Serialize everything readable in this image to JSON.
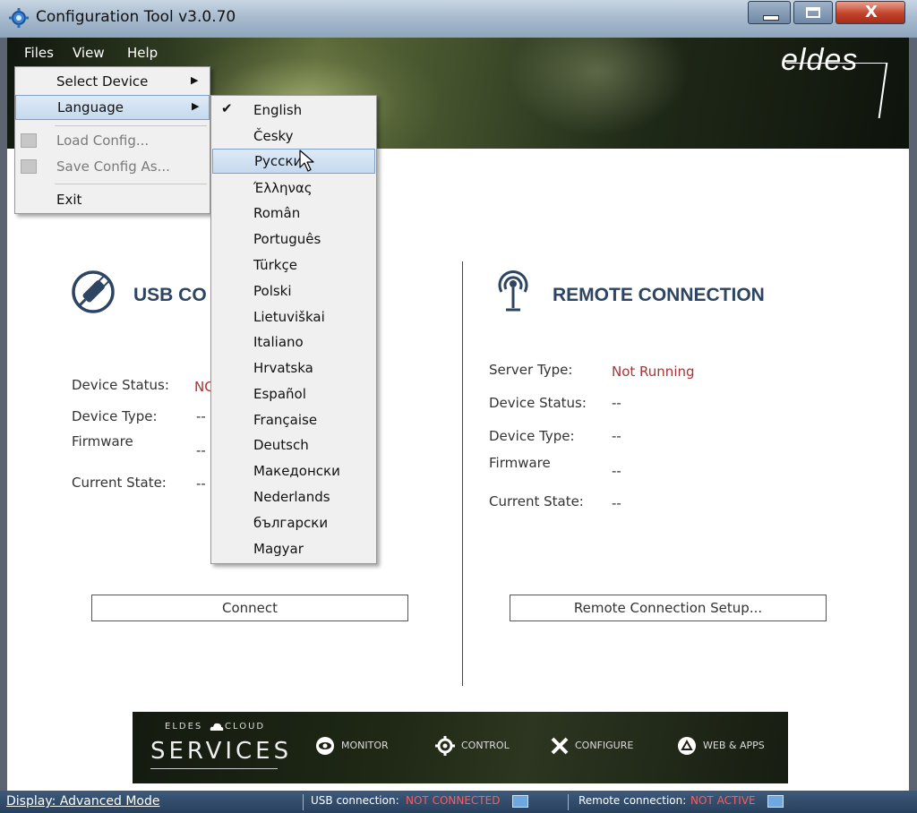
{
  "window": {
    "title": "Configuration Tool v3.0.70"
  },
  "menubar": {
    "files": "Files",
    "view": "View",
    "help": "Help"
  },
  "brand": {
    "logo": "eldes"
  },
  "files_menu": {
    "items": [
      {
        "label": "Select Device",
        "submenu": true
      },
      {
        "label": "Language",
        "submenu": true,
        "highlighted": true
      },
      {
        "label": "Load Config...",
        "disabled": true,
        "icon": "load-config-icon"
      },
      {
        "label": "Save Config As...",
        "disabled": true,
        "icon": "save-config-icon"
      },
      {
        "label": "Exit"
      }
    ]
  },
  "language_menu": {
    "selected": "English",
    "hovered": "Русски",
    "items": [
      "English",
      "Česky",
      "Русски",
      "Έλληνας",
      "Român",
      "Português",
      "Türkçe",
      "Polski",
      "Lietuviškai",
      "Italiano",
      "Hrvatska",
      "Español",
      "Française",
      "Deutsch",
      "Македонски",
      "Nederlands",
      "български",
      "Magyar"
    ]
  },
  "usb": {
    "heading": "USB CO",
    "device_status_label": "Device Status:",
    "device_status_value": "NC",
    "device_type_label": "Device Type:",
    "device_type_value": "--",
    "firmware_label": "Firmware",
    "firmware_value": "--",
    "current_state_label": "Current State:",
    "current_state_value": "--",
    "connect_button": "Connect"
  },
  "remote": {
    "heading": "REMOTE CONNECTION",
    "server_type_label": "Server Type:",
    "server_type_value": "Not Running",
    "device_status_label": "Device Status:",
    "device_status_value": "--",
    "device_type_label": "Device Type:",
    "device_type_value": "--",
    "firmware_label": "Firmware",
    "firmware_value": "--",
    "current_state_label": "Current State:",
    "current_state_value": "--",
    "setup_button": "Remote Connection Setup..."
  },
  "services": {
    "eldes": "ELDES",
    "cloud": "CLOUD",
    "title": "SERVICES",
    "items": [
      {
        "label": "MONITOR",
        "icon": "eye-icon"
      },
      {
        "label": "CONTROL",
        "icon": "gear-icon"
      },
      {
        "label": "CONFIGURE",
        "icon": "tools-icon"
      },
      {
        "label": "WEB & APPS",
        "icon": "apps-icon"
      }
    ]
  },
  "statusbar": {
    "display_mode": "Display: Advanced Mode",
    "usb_label": "USB connection:",
    "usb_value": "NOT CONNECTED",
    "remote_label": "Remote connection:",
    "remote_value": "NOT ACTIVE"
  },
  "colors": {
    "heading": "#2d4562",
    "status_red": "#a33",
    "status_bar_red": "#ff5b5b",
    "highlight": "#c4d9ef"
  }
}
